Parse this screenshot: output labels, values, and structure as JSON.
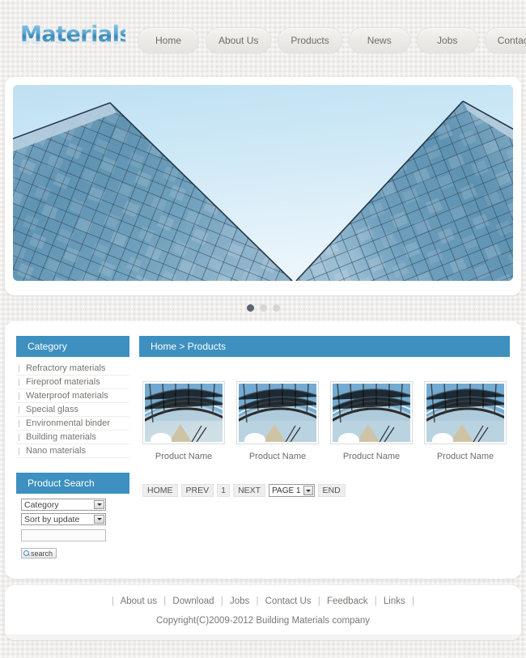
{
  "site": {
    "logo_text": "Materials",
    "brand_color": "#3d90bf"
  },
  "nav": {
    "items": [
      {
        "label": "Home"
      },
      {
        "label": "About Us"
      },
      {
        "label": "Products"
      },
      {
        "label": "News"
      },
      {
        "label": "Jobs"
      },
      {
        "label": "Contact Us"
      }
    ]
  },
  "banner": {
    "alt": "glass office towers against blue sky",
    "slides": [
      {
        "active": true
      },
      {
        "active": false
      },
      {
        "active": false
      }
    ]
  },
  "sidebar": {
    "category": {
      "title": "Category",
      "items": [
        {
          "label": "Refractory materials"
        },
        {
          "label": "Fireproof materials"
        },
        {
          "label": "Waterproof materials"
        },
        {
          "label": "Special glass"
        },
        {
          "label": "Environmental binder"
        },
        {
          "label": "Building materials"
        },
        {
          "label": "Nano materials"
        }
      ]
    },
    "search": {
      "title": "Product Search",
      "category_select": "Category",
      "sort_select": "Sort by update",
      "keyword_value": "",
      "keyword_placeholder": "",
      "button_label": "search"
    }
  },
  "content": {
    "breadcrumb": "Home > Products",
    "products": [
      {
        "name": "Product Name"
      },
      {
        "name": "Product Name"
      },
      {
        "name": "Product Name"
      },
      {
        "name": "Product Name"
      }
    ],
    "pager": {
      "home": "HOME",
      "prev": "PREV",
      "current": "1",
      "next": "NEXT",
      "page_select": "PAGE 1",
      "end": "END"
    }
  },
  "footer": {
    "links": [
      {
        "label": "About us"
      },
      {
        "label": "Download"
      },
      {
        "label": "Jobs"
      },
      {
        "label": "Contact Us"
      },
      {
        "label": "Feedback"
      },
      {
        "label": "Links"
      }
    ],
    "copyright": "Copyright(C)2009-2012 Building Materials company"
  }
}
